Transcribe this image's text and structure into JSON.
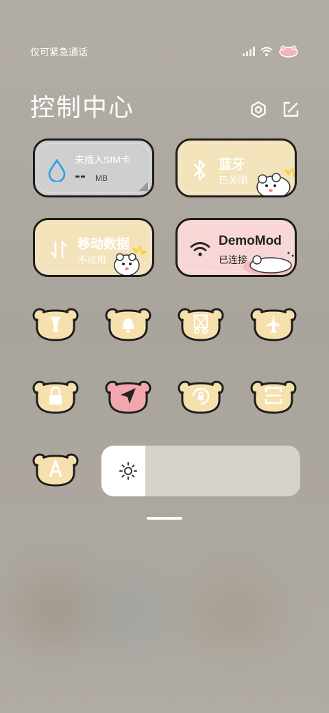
{
  "status_bar": {
    "carrier_text": "仅可紧急通话",
    "icons": [
      "signal-icon",
      "wifi-icon",
      "battery-icon"
    ]
  },
  "header": {
    "title": "控制中心",
    "settings_icon": "gear-icon",
    "edit_icon": "edit-icon"
  },
  "tiles": {
    "data_usage": {
      "title": "未插入SIM卡",
      "value": "--",
      "unit": "MB",
      "icon": "water-drop-icon",
      "color": "#cfcfcf"
    },
    "bluetooth": {
      "title": "蓝牙",
      "status": "已关闭",
      "icon": "bluetooth-icon",
      "color": "#f3e3bb"
    },
    "mobile_data": {
      "title": "移动数据",
      "status": "不可用",
      "icon": "data-transfer-icon",
      "color": "#f3e3bb"
    },
    "wlan": {
      "title": "DemoMod",
      "status": "已连接",
      "icon": "wifi-icon",
      "color": "#f8d6d6"
    }
  },
  "quick_toggles": [
    {
      "name": "flashlight",
      "icon": "flashlight-icon",
      "active": false
    },
    {
      "name": "silent",
      "icon": "bell-icon",
      "active": false
    },
    {
      "name": "screenshot",
      "icon": "scissors-icon",
      "active": false
    },
    {
      "name": "airplane",
      "icon": "airplane-icon",
      "active": false
    },
    {
      "name": "lock",
      "icon": "lock-icon",
      "active": false
    },
    {
      "name": "location",
      "icon": "location-arrow-icon",
      "active": true
    },
    {
      "name": "rotation-lock",
      "icon": "rotation-lock-icon",
      "active": false
    },
    {
      "name": "fullscreen",
      "icon": "fullscreen-icon",
      "active": false
    },
    {
      "name": "auto-brightness",
      "icon": "letter-a-icon",
      "active": false
    }
  ],
  "brightness": {
    "level": 0.22,
    "icon": "sun-icon"
  },
  "colors": {
    "bear_yellow": "#f6e1ae",
    "bear_pink": "#f2a7b0",
    "outline": "#1c1c1c"
  }
}
